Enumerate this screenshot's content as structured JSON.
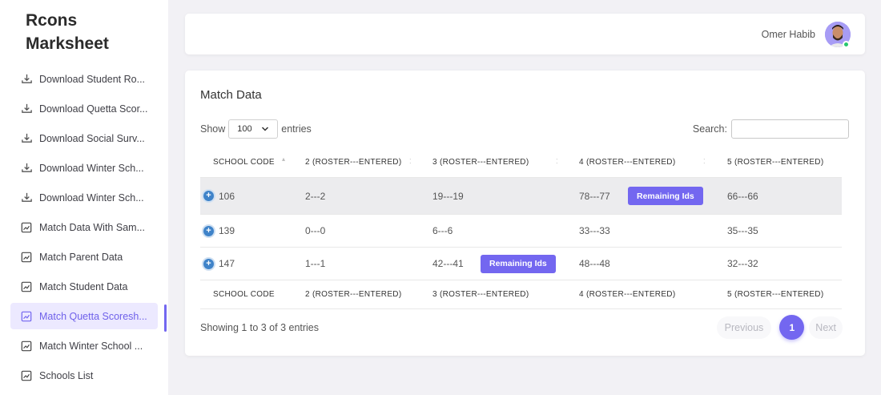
{
  "brand": {
    "line1": "Rcons",
    "line2": "Marksheet"
  },
  "sidebar": {
    "items": [
      {
        "label": "Download Student Ro...",
        "icon": "download-icon"
      },
      {
        "label": "Download Quetta Scor...",
        "icon": "download-icon"
      },
      {
        "label": "Download Social Surv...",
        "icon": "download-icon"
      },
      {
        "label": "Download Winter Sch...",
        "icon": "download-icon"
      },
      {
        "label": "Download Winter Sch...",
        "icon": "download-icon"
      },
      {
        "label": "Match Data With Sam...",
        "icon": "chart-icon"
      },
      {
        "label": "Match Parent Data",
        "icon": "chart-icon"
      },
      {
        "label": "Match Student Data",
        "icon": "chart-icon"
      },
      {
        "label": "Match Quetta Scoresh...",
        "icon": "chart-icon",
        "active": true
      },
      {
        "label": "Match Winter School ...",
        "icon": "chart-icon"
      },
      {
        "label": "Schools List",
        "icon": "chart-icon"
      }
    ]
  },
  "header": {
    "user_name": "Omer Habib"
  },
  "card": {
    "title": "Match Data",
    "show_label": "Show",
    "entries_value": "100",
    "entries_label": "entries",
    "search_label": "Search:",
    "search_value": ""
  },
  "table": {
    "columns": [
      "SCHOOL CODE",
      "2 (ROSTER---ENTERED)",
      "3 (ROSTER---ENTERED)",
      "4 (ROSTER---ENTERED)",
      "5 (ROSTER---ENTERED)"
    ],
    "rows": [
      {
        "code": "106",
        "c2": "2---2",
        "c3": "19---19",
        "c4": "78---77",
        "c5": "66---66"
      },
      {
        "code": "139",
        "c2": "0---0",
        "c3": "6---6",
        "c4": "33---33",
        "c5": "35---35"
      },
      {
        "code": "147",
        "c2": "1---1",
        "c3": "42---41",
        "c4": "48---48",
        "c5": "32---32"
      }
    ],
    "remaining_label": "Remaining Ids"
  },
  "footer": {
    "info": "Showing 1 to 3 of 3 entries",
    "prev": "Previous",
    "page": "1",
    "next": "Next"
  },
  "colors": {
    "accent": "#7367f0",
    "online": "#28c76f",
    "expand": "#3f83c9"
  }
}
